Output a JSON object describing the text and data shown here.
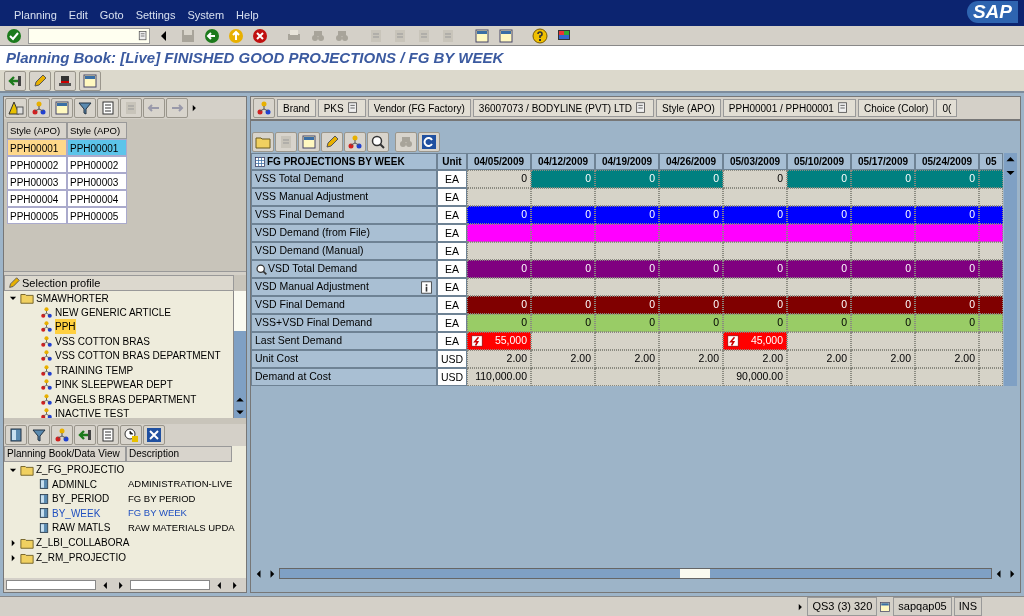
{
  "menu": [
    "Planning",
    "Edit",
    "Goto",
    "Settings",
    "System",
    "Help"
  ],
  "logo": "SAP",
  "title": "Planning Book: [Live] FINISHED GOOD PROJECTIONS / FG BY WEEK",
  "style_table": {
    "columns": [
      "Style (APO)",
      "Style (APO)"
    ],
    "rows": [
      {
        "cells": [
          "PPH00001",
          "PPH00001"
        ],
        "selected": true
      },
      {
        "cells": [
          "PPH00002",
          "PPH00002"
        ],
        "selected": false
      },
      {
        "cells": [
          "PPH00003",
          "PPH00003"
        ],
        "selected": false
      },
      {
        "cells": [
          "PPH00004",
          "PPH00004"
        ],
        "selected": false
      },
      {
        "cells": [
          "PPH00005",
          "PPH00005"
        ],
        "selected": false
      }
    ]
  },
  "selection_profile": {
    "label": "Selection profile",
    "tree": [
      {
        "label": "SMAWHORTER",
        "expanded": true,
        "children": [
          {
            "label": "NEW GENERIC ARTICLE",
            "selected": false
          },
          {
            "label": "PPH",
            "selected": true
          },
          {
            "label": "VSS COTTON BRAS",
            "selected": false
          },
          {
            "label": "VSS COTTON BRAS DEPARTMENT",
            "selected": false
          },
          {
            "label": "TRAINING TEMP",
            "selected": false
          },
          {
            "label": "PINK SLEEPWEAR DEPT",
            "selected": false
          },
          {
            "label": "ANGELS BRAS DEPARTMENT",
            "selected": false
          },
          {
            "label": "INACTIVE TEST",
            "selected": false
          }
        ]
      }
    ]
  },
  "planning_books": {
    "columns": [
      "Planning Book/Data View",
      "Description"
    ],
    "tree": [
      {
        "label": "Z_FG_PROJECTIO",
        "expanded": true,
        "children": [
          {
            "label": "ADMINLC",
            "description": "ADMINISTRATION-LIVE",
            "selected": false
          },
          {
            "label": "BY_PERIOD",
            "description": "FG BY PERIOD",
            "selected": false
          },
          {
            "label": "BY_WEEK",
            "description": "FG BY WEEK",
            "selected": true
          },
          {
            "label": "RAW MATLS",
            "description": "RAW MATERIALS UPDA",
            "selected": false
          }
        ]
      },
      {
        "label": "Z_LBI_COLLABORA",
        "expanded": false
      },
      {
        "label": "Z_RM_PROJECTIO",
        "expanded": false
      }
    ]
  },
  "filter_bar": [
    {
      "text": "Brand",
      "kind": "label"
    },
    {
      "text": "PKS",
      "kind": "value"
    },
    {
      "text": "Vendor (FG Factory)",
      "kind": "label"
    },
    {
      "text": "36007073 / BODYLINE (PVT) LTD",
      "kind": "value"
    },
    {
      "text": "Style (APO)",
      "kind": "label"
    },
    {
      "text": "PPH00001 / PPH00001",
      "kind": "value"
    },
    {
      "text": "Choice (Color)",
      "kind": "label"
    },
    {
      "text": "0(",
      "kind": "label"
    }
  ],
  "grid": {
    "title": "FG PROJECTIONS BY WEEK",
    "unit_header": "Unit",
    "columns": [
      "04/05/2009",
      "04/12/2009",
      "04/19/2009",
      "04/26/2009",
      "05/03/2009",
      "05/10/2009",
      "05/17/2009",
      "05/24/2009",
      "05"
    ],
    "rows": [
      {
        "label": "VSS Total Demand",
        "kind": "plain",
        "unit": "EA",
        "cells": [
          {
            "text": "0",
            "color": "#d6d3c8"
          },
          {
            "text": "0",
            "color": "#008080"
          },
          {
            "text": "0",
            "color": "#008080"
          },
          {
            "text": "0",
            "color": "#008080"
          },
          {
            "text": "0",
            "color": "#d6d3c8"
          },
          {
            "text": "0",
            "color": "#008080"
          },
          {
            "text": "0",
            "color": "#008080"
          },
          {
            "text": "0",
            "color": "#008080"
          },
          {
            "color": "#008080"
          }
        ]
      },
      {
        "label": "VSS Manual Adjustment",
        "kind": "plain",
        "unit": "EA",
        "cells": [
          {
            "color": "#d6d3c8"
          },
          {
            "color": "#d6d3c8"
          },
          {
            "color": "#d6d3c8"
          },
          {
            "color": "#d6d3c8"
          },
          {
            "color": "#d6d3c8"
          },
          {
            "color": "#d6d3c8"
          },
          {
            "color": "#d6d3c8"
          },
          {
            "color": "#d6d3c8"
          },
          {
            "color": "#d6d3c8"
          }
        ]
      },
      {
        "label": "VSS Final Demand",
        "kind": "plain",
        "unit": "EA",
        "cells": [
          {
            "text": "0",
            "color": "#0000ff"
          },
          {
            "text": "0",
            "color": "#0000ff"
          },
          {
            "text": "0",
            "color": "#0000ff"
          },
          {
            "text": "0",
            "color": "#0000ff"
          },
          {
            "text": "0",
            "color": "#0000ff"
          },
          {
            "text": "0",
            "color": "#0000ff"
          },
          {
            "text": "0",
            "color": "#0000ff"
          },
          {
            "text": "0",
            "color": "#0000ff"
          },
          {
            "color": "#0000ff"
          }
        ]
      },
      {
        "label": "VSD Demand (from File)",
        "kind": "plain",
        "unit": "EA",
        "cells": [
          {
            "color": "#ff00ff"
          },
          {
            "color": "#ff00ff"
          },
          {
            "color": "#ff00ff"
          },
          {
            "color": "#ff00ff"
          },
          {
            "color": "#ff00ff"
          },
          {
            "color": "#ff00ff"
          },
          {
            "color": "#ff00ff"
          },
          {
            "color": "#ff00ff"
          },
          {
            "color": "#ff00ff"
          }
        ]
      },
      {
        "label": "VSD Demand (Manual)",
        "kind": "plain",
        "unit": "EA",
        "cells": [
          {
            "color": "#d6d3c8"
          },
          {
            "color": "#d6d3c8"
          },
          {
            "color": "#d6d3c8"
          },
          {
            "color": "#d6d3c8"
          },
          {
            "color": "#d6d3c8"
          },
          {
            "color": "#d6d3c8"
          },
          {
            "color": "#d6d3c8"
          },
          {
            "color": "#d6d3c8"
          },
          {
            "color": "#d6d3c8"
          }
        ]
      },
      {
        "label": "VSD Total Demand",
        "kind": "zoom",
        "unit": "EA",
        "cells": [
          {
            "text": "0",
            "color": "#800080"
          },
          {
            "text": "0",
            "color": "#800080"
          },
          {
            "text": "0",
            "color": "#800080"
          },
          {
            "text": "0",
            "color": "#800080"
          },
          {
            "text": "0",
            "color": "#800080"
          },
          {
            "text": "0",
            "color": "#800080"
          },
          {
            "text": "0",
            "color": "#800080"
          },
          {
            "text": "0",
            "color": "#800080"
          },
          {
            "color": "#800080"
          }
        ]
      },
      {
        "label": "VSD Manual Adjustment",
        "kind": "info",
        "unit": "EA",
        "cells": [
          {
            "color": "#d6d3c8"
          },
          {
            "color": "#d6d3c8"
          },
          {
            "color": "#d6d3c8"
          },
          {
            "color": "#d6d3c8"
          },
          {
            "color": "#d6d3c8"
          },
          {
            "color": "#d6d3c8"
          },
          {
            "color": "#d6d3c8"
          },
          {
            "color": "#d6d3c8"
          },
          {
            "color": "#d6d3c8"
          }
        ]
      },
      {
        "label": "VSD Final Demand",
        "kind": "plain",
        "unit": "EA",
        "cells": [
          {
            "text": "0",
            "color": "#800000"
          },
          {
            "text": "0",
            "color": "#800000"
          },
          {
            "text": "0",
            "color": "#800000"
          },
          {
            "text": "0",
            "color": "#800000"
          },
          {
            "text": "0",
            "color": "#800000"
          },
          {
            "text": "0",
            "color": "#800000"
          },
          {
            "text": "0",
            "color": "#800000"
          },
          {
            "text": "0",
            "color": "#800000"
          },
          {
            "color": "#800000"
          }
        ]
      },
      {
        "label": "VSS+VSD Final Demand",
        "kind": "plain",
        "unit": "EA",
        "cells": [
          {
            "text": "0",
            "color": "#99cc66"
          },
          {
            "text": "0",
            "color": "#99cc66"
          },
          {
            "text": "0",
            "color": "#99cc66"
          },
          {
            "text": "0",
            "color": "#99cc66"
          },
          {
            "text": "0",
            "color": "#99cc66"
          },
          {
            "text": "0",
            "color": "#99cc66"
          },
          {
            "text": "0",
            "color": "#99cc66"
          },
          {
            "text": "0",
            "color": "#99cc66"
          },
          {
            "color": "#99cc66"
          }
        ]
      },
      {
        "label": "Last Sent Demand",
        "kind": "plain",
        "unit": "EA",
        "cells": [
          {
            "text": "55,000",
            "color": "#ff0000",
            "alert": true
          },
          {
            "color": "#d6d3c8",
            "alert": false
          },
          {
            "color": "#d6d3c8",
            "alert": false
          },
          {
            "color": "#d6d3c8",
            "alert": false
          },
          {
            "text": "45,000",
            "color": "#ff0000",
            "alert": true
          },
          {
            "color": "#d6d3c8",
            "alert": false
          },
          {
            "color": "#d6d3c8",
            "alert": false
          },
          {
            "color": "#d6d3c8",
            "alert": false
          },
          {
            "color": "#d6d3c8",
            "alert": false
          }
        ]
      },
      {
        "label": "Unit Cost",
        "kind": "plain",
        "unit": "USD",
        "cells": [
          {
            "text": "2.00",
            "color": "#d6d3c8"
          },
          {
            "text": "2.00",
            "color": "#d6d3c8"
          },
          {
            "text": "2.00",
            "color": "#d6d3c8"
          },
          {
            "text": "2.00",
            "color": "#d6d3c8"
          },
          {
            "text": "2.00",
            "color": "#d6d3c8"
          },
          {
            "text": "2.00",
            "color": "#d6d3c8"
          },
          {
            "text": "2.00",
            "color": "#d6d3c8"
          },
          {
            "text": "2.00",
            "color": "#d6d3c8"
          },
          {
            "color": "#d6d3c8"
          }
        ]
      },
      {
        "label": "Demand at Cost",
        "kind": "plain",
        "unit": "USD",
        "cells": [
          {
            "text": "110,000.00",
            "color": "#d6d3c8"
          },
          {
            "color": "#d6d3c8"
          },
          {
            "color": "#d6d3c8"
          },
          {
            "color": "#d6d3c8"
          },
          {
            "text": "90,000.00",
            "color": "#d6d3c8"
          },
          {
            "color": "#d6d3c8"
          },
          {
            "color": "#d6d3c8"
          },
          {
            "color": "#d6d3c8"
          },
          {
            "color": "#d6d3c8"
          }
        ]
      }
    ]
  },
  "status_bar": {
    "system": "QS3 (3) 320",
    "server": "sapqap05",
    "mode": "INS"
  }
}
